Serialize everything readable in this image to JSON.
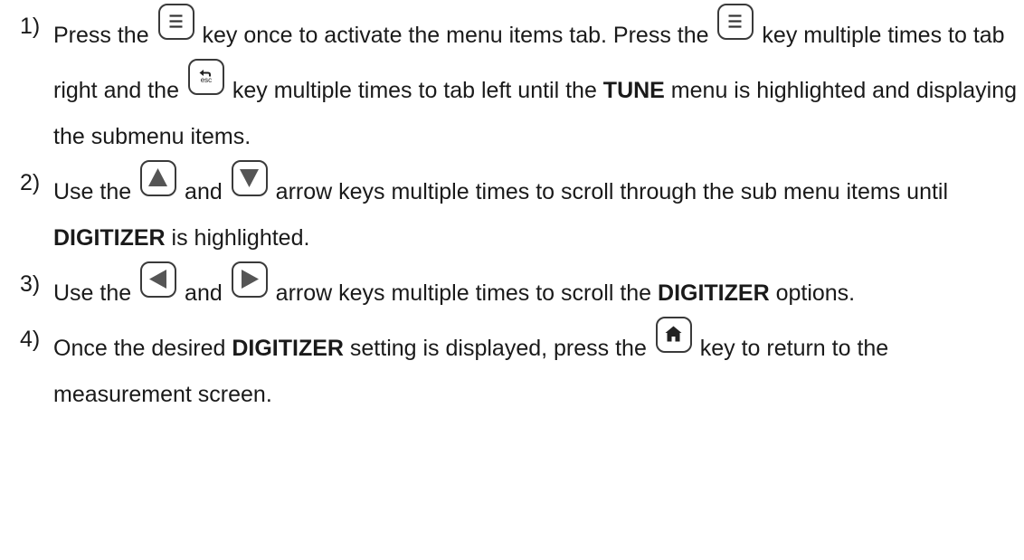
{
  "steps": [
    {
      "num": "1)",
      "parts": {
        "a": "Press the ",
        "b": " key once to activate the menu items tab.  Press the ",
        "c": " key multiple times to tab right and the ",
        "d": " key multiple times to tab left until the ",
        "e": "TUNE",
        "f": " menu is highlighted and displaying the submenu items."
      },
      "icons": [
        "menu-key",
        "menu-key",
        "esc-key"
      ]
    },
    {
      "num": "2)",
      "parts": {
        "a": "Use the ",
        "b": " and ",
        "c": " arrow keys multiple times to scroll through the sub menu items until ",
        "d": "DIGITIZER",
        "e": " is highlighted."
      },
      "icons": [
        "up-arrow-key",
        "down-arrow-key"
      ]
    },
    {
      "num": "3)",
      "parts": {
        "a": "Use the ",
        "b": " and ",
        "c": " arrow keys multiple times to scroll the ",
        "d": "DIGITIZER",
        "e": " options."
      },
      "icons": [
        "left-arrow-key",
        "right-arrow-key"
      ]
    },
    {
      "num": "4)",
      "parts": {
        "a": "Once the desired ",
        "b": "DIGITIZER",
        "c": " setting is displayed, press the ",
        "d": " key to return to the measurement screen."
      },
      "icons": [
        "home-key"
      ]
    }
  ],
  "keys": {
    "esc_label": "esc"
  }
}
